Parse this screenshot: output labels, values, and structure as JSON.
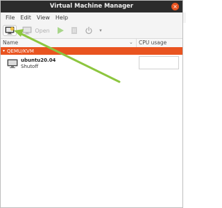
{
  "window": {
    "title": "Virtual Machine Manager",
    "close_glyph": "×"
  },
  "menu": {
    "items": [
      {
        "label": "File"
      },
      {
        "label": "Edit"
      },
      {
        "label": "View"
      },
      {
        "label": "Help"
      }
    ]
  },
  "toolbar": {
    "new_vm_icon": "new-vm-icon",
    "open_label": "Open",
    "open_icon": "monitor-icon",
    "run_icon": "play-icon",
    "pause_icon": "pause-icon",
    "shutdown_icon": "power-icon",
    "dropdown_glyph": "▾"
  },
  "columns": {
    "name": "Name",
    "cpu": "CPU usage",
    "sort_glyph": "⌄"
  },
  "connection": {
    "arrow": "▾",
    "label": "QEMU/KVM"
  },
  "vms": [
    {
      "name": "ubuntu20.04",
      "status": "Shutoff",
      "icon": "vm-monitor-icon"
    }
  ],
  "colors": {
    "accent": "#e95420",
    "titlebar": "#2c2c2c",
    "annotation_arrow": "#8dc63f"
  }
}
